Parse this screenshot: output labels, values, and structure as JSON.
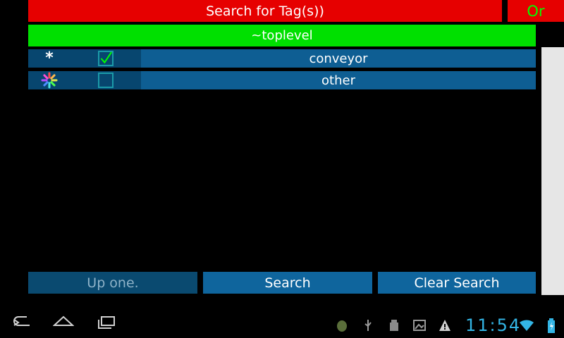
{
  "header": {
    "title": "Search for Tag(s))",
    "mode_toggle": "Or"
  },
  "path": {
    "current": "~toplevel"
  },
  "tags": [
    {
      "label": "conveyor",
      "icon": "asterisk-icon",
      "checked": true
    },
    {
      "label": "other",
      "icon": "colorful-spinner-icon",
      "checked": false
    }
  ],
  "buttons": {
    "up_one": "Up one.",
    "search": "Search",
    "clear_search": "Clear Search"
  },
  "system_bar": {
    "time": "11:54",
    "accent_color": "#33b5e5"
  },
  "colors": {
    "title_bg": "#e60000",
    "path_bg": "#00e000",
    "row_bg": "#0e5e93",
    "button_bg": "#0f659d"
  }
}
